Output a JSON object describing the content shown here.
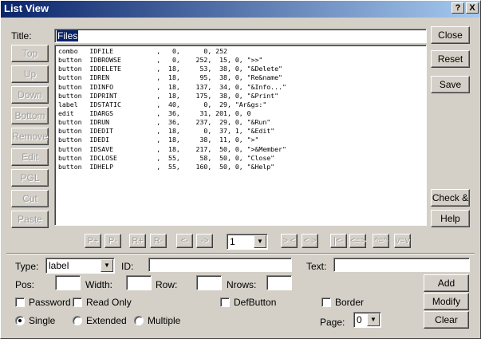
{
  "window": {
    "title": "List View"
  },
  "titlebar_buttons": {
    "help": "?",
    "close": "X"
  },
  "title_field": {
    "label": "Title:",
    "value": "Files"
  },
  "left_buttons": [
    "Top",
    "Up",
    "Down",
    "Bottom",
    "Remove",
    "Edit",
    "PGL",
    "Cut",
    "Paste"
  ],
  "right_buttons": {
    "close": "Close",
    "reset": "Reset",
    "save": "Save",
    "check": "Check &",
    "help": "Help"
  },
  "list_rows": [
    "combo   IDFILE           ,   0,      0, 252",
    "button  IDBROWSE         ,   0,    252,  15, 0, \">>\"",
    "button  IDDELETE         ,  18,     53,  38, 0, \"&Delete\"",
    "button  IDREN            ,  18,     95,  38, 0, \"Re&name\"",
    "button  IDINFO           ,  18,    137,  34, 0, \"&Info...\"",
    "button  IDPRINT          ,  18,    175,  38, 0, \"&Print\"",
    "label   IDSTATIC         ,  40,      0,  29, \"Ar&gs:\"",
    "edit    IDARGS           ,  36,     31, 201, 0, 0",
    "button  IDRUN            ,  36,    237,  29, 0, \"&Run\"",
    "button  IDEDIT           ,  18,      0,  37, 1, \"&Edit\"",
    "button  IDEDI            ,  18,     38,  11, 0, \">\"",
    "button  IDSAVE           ,  18,    217,  50, 0, \">&Member\"",
    "button  IDCLOSE          ,  55,     58,  50, 0, \"Close\"",
    "button  IDHELP           ,  55,    160,  50, 0, \"&Help\""
  ],
  "nav_buttons": [
    "P+",
    "P-",
    "R+",
    "R-",
    "<-",
    "->",
    "> <",
    "< >",
    "|<-",
    "<=>",
    "^=^",
    "v=v"
  ],
  "page_select": {
    "value": "1"
  },
  "type_field": {
    "label": "Type:",
    "value": "label"
  },
  "id_field": {
    "label": "ID:",
    "value": ""
  },
  "text_field": {
    "label": "Text:",
    "value": ""
  },
  "pos": {
    "label": "Pos:",
    "value": ""
  },
  "width": {
    "label": "Width:",
    "value": ""
  },
  "row": {
    "label": "Row:",
    "value": ""
  },
  "nrows": {
    "label": "Nrows:",
    "value": ""
  },
  "checkboxes": {
    "password": "Password",
    "readonly": "Read Only",
    "defbutton": "DefButton",
    "border": "Border"
  },
  "radios": {
    "single": "Single",
    "extended": "Extended",
    "multiple": "Multiple"
  },
  "action_buttons": {
    "add": "Add",
    "modify": "Modify",
    "clear": "Clear"
  },
  "page_field": {
    "label": "Page:",
    "value": "0"
  }
}
